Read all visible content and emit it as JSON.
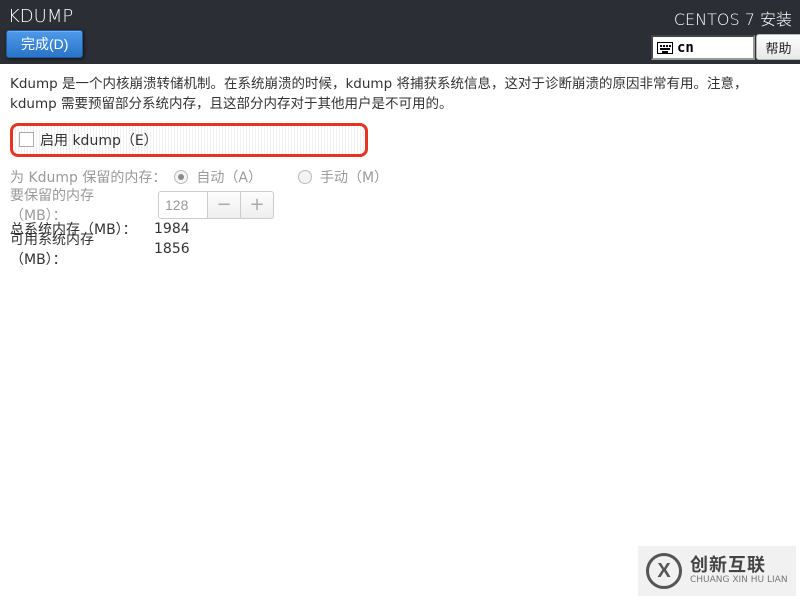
{
  "header": {
    "title": "KDUMP",
    "install_label": "CENTOS 7 安装",
    "done_label": "完成(D)",
    "locale": "cn",
    "help_label": "帮助"
  },
  "description": "Kdump 是一个内核崩溃转储机制。在系统崩溃的时候，kdump 将捕获系统信息，这对于诊断崩溃的原因非常有用。注意，kdump 需要预留部分系统内存，且这部分内存对于其他用户是不可用的。",
  "enable": {
    "label": "启用 kdump（E）",
    "checked": false
  },
  "reserve": {
    "label": "为 Kdump 保留的内存：",
    "auto_label": "自动（A）",
    "manual_label": "手动（M）",
    "mode": "auto"
  },
  "to_reserve": {
    "label": "要保留的内存（MB）：",
    "value": "128"
  },
  "total_mem": {
    "label": "总系统内存（MB）：",
    "value": "1984"
  },
  "usable_mem": {
    "label": "可用系统内存（MB）：",
    "value": "1856"
  },
  "watermark": {
    "logo_letter": "X",
    "cn": "创新互联",
    "py": "CHUANG XIN HU LIAN"
  }
}
